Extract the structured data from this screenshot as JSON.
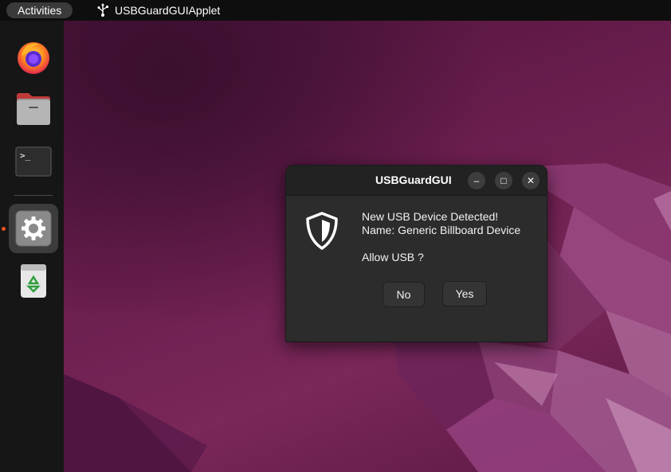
{
  "topbar": {
    "activities_label": "Activities",
    "app_name": "USBGuardGUIApplet"
  },
  "dock": {
    "items": [
      {
        "name": "Firefox",
        "icon": "firefox-icon"
      },
      {
        "name": "Files",
        "icon": "files-icon"
      },
      {
        "name": "Terminal",
        "icon": "terminal-icon",
        "glyph": ">_"
      },
      {
        "name": "Settings",
        "icon": "gear-icon",
        "active": true
      },
      {
        "name": "Trash",
        "icon": "trash-icon"
      }
    ]
  },
  "dialog": {
    "title": "USBGuardGUI",
    "icon": "shield-icon",
    "message_line1": "New USB Device Detected!",
    "message_line2": "Name: Generic Billboard Device",
    "question": "Allow USB ?",
    "no_label": "No",
    "yes_label": "Yes",
    "minimize_glyph": "–",
    "maximize_glyph": "□",
    "close_glyph": "✕"
  },
  "colors": {
    "accent": "#e95420",
    "topbar": "#0e0e0e",
    "dock": "#161616",
    "dialog_bg": "#2c2c2c",
    "wallpaper": "#6b1e4f"
  }
}
